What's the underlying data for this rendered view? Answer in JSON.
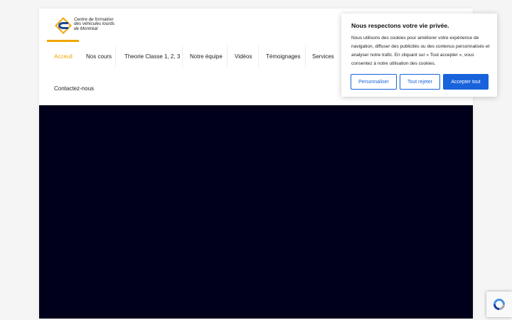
{
  "logo": {
    "line1": "Centre de formation",
    "line2": "des véhicules lourds",
    "line3": "de Montréal"
  },
  "nav": {
    "items": [
      {
        "label": "Acceuil",
        "active": true
      },
      {
        "label": "Nos cours"
      },
      {
        "label": "Theorie Classe 1, 2, 3"
      },
      {
        "label": "Notre équipe"
      },
      {
        "label": "Vidéos"
      },
      {
        "label": "Témoignages"
      },
      {
        "label": "Services"
      },
      {
        "label": "Contactez-nous"
      }
    ]
  },
  "cookie": {
    "title": "Nous respectons votre vie privée.",
    "text": "Nous utilisons des cookies pour améliorer votre expérience de navigation, diffuser des publicités ou des contenus personnalisés et analyser notre trafic. En cliquant sur « Tout accepter », vous consentez à notre utilisation des cookies.",
    "customize_label": "Personnaliser",
    "reject_label": "Tout rejeter",
    "accept_label": "Accepter tout"
  },
  "colors": {
    "accent": "#f0a500",
    "cookie_button": "#1863dc",
    "video_bg": "#01001a"
  },
  "icons": {
    "logo": "diamond-truck-logo-icon",
    "recaptcha": "recaptcha-icon"
  }
}
